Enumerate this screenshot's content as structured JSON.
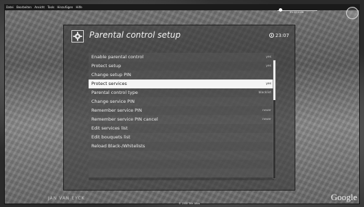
{
  "menubar": {
    "items": [
      "Datei",
      "Bearbeiten",
      "Ansicht",
      "Tools",
      "Hinzufügen",
      "Hilfe"
    ]
  },
  "map": {
    "nav_caption": "01.12.2008",
    "watermark": "Google",
    "copyright": "© 2008 Tele Atlas",
    "street_label": "JAN VAN EYCK"
  },
  "dialog": {
    "title": "Parental control setup",
    "clock": "23:07",
    "items": [
      {
        "label": "Enable parental control",
        "value": "yes"
      },
      {
        "label": "Protect setup",
        "value": "yes"
      },
      {
        "label": "Change setup PIN",
        "value": ""
      },
      {
        "label": "Protect services",
        "value": "yes"
      },
      {
        "label": "Parental control type",
        "value": "blacklist"
      },
      {
        "label": "Change service PIN",
        "value": ""
      },
      {
        "label": "Remember service PIN",
        "value": "never"
      },
      {
        "label": "Remember service PIN cancel",
        "value": "never"
      },
      {
        "label": "Edit services list",
        "value": ""
      },
      {
        "label": "Edit bouquets list",
        "value": ""
      },
      {
        "label": "Reload Black-/Whitelists",
        "value": ""
      }
    ],
    "selected_index": 3
  },
  "icons": {
    "header": "gear-icon",
    "clock": "clock-icon",
    "map_nav": "timeline-slider-icon",
    "compass": "compass-icon"
  },
  "colors": {
    "selection_bg": "#f5f5f5",
    "dialog_bg": "#3c3c3c"
  }
}
